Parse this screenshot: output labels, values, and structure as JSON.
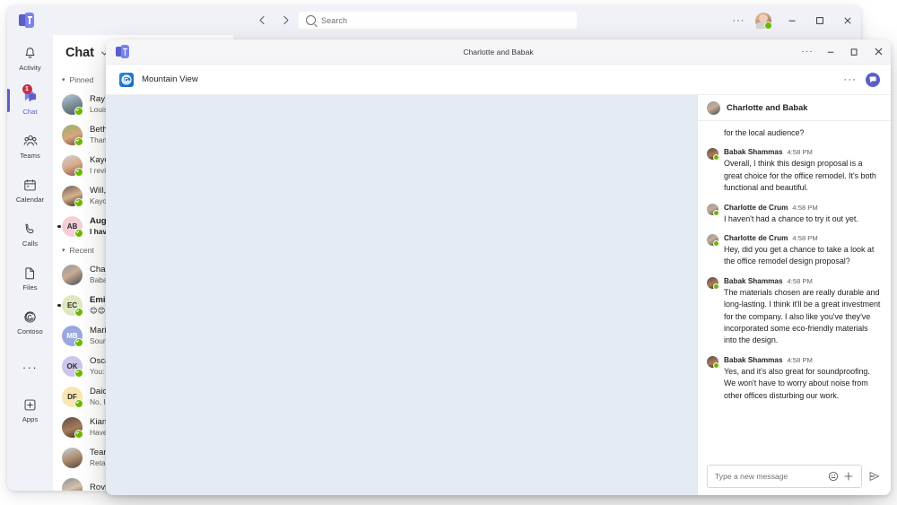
{
  "outer_window": {
    "logo_icon": "teams-logo-icon",
    "nav": {
      "back_icon": "chevron-left-icon",
      "forward_icon": "chevron-right-icon"
    },
    "search": {
      "placeholder": "Search",
      "icon": "search-icon"
    },
    "more_label": "···",
    "avatar_presence": "available",
    "controls": {
      "minimize": "‒",
      "maximize": "☐",
      "close": "✕"
    }
  },
  "rail": {
    "items": [
      {
        "label": "Activity",
        "icon": "bell-icon",
        "active": false,
        "badge": ""
      },
      {
        "label": "Chat",
        "icon": "chat-icon",
        "active": true,
        "badge": "1"
      },
      {
        "label": "Teams",
        "icon": "people-icon",
        "active": false,
        "badge": ""
      },
      {
        "label": "Calendar",
        "icon": "calendar-icon",
        "active": false,
        "badge": ""
      },
      {
        "label": "Calls",
        "icon": "phone-icon",
        "active": false,
        "badge": ""
      },
      {
        "label": "Files",
        "icon": "file-icon",
        "active": false,
        "badge": ""
      },
      {
        "label": "Contoso",
        "icon": "contoso-swirl-icon",
        "active": false,
        "badge": ""
      }
    ],
    "more_label": "···",
    "apps": {
      "label": "Apps",
      "icon": "apps-plus-icon"
    }
  },
  "chat_pane": {
    "title": "Chat",
    "chevron_icon": "chevron-down-icon",
    "groups": [
      {
        "name": "Pinned",
        "items": [
          {
            "name": "Ray Ta",
            "preview": "Louisa",
            "unread": false,
            "initials": "",
            "face": "f1"
          },
          {
            "name": "Beth D",
            "preview": "Thanks",
            "unread": false,
            "initials": "",
            "face": "f2"
          },
          {
            "name": "Kayo ",
            "preview": "I review",
            "unread": false,
            "initials": "",
            "face": "f3"
          },
          {
            "name": "Will, K",
            "preview": "Kayo: It",
            "unread": false,
            "initials": "",
            "face": "f4"
          },
          {
            "name": "Augu",
            "preview": "I haven",
            "unread": true,
            "initials": "AB",
            "face": ""
          }
        ]
      },
      {
        "name": "Recent",
        "items": [
          {
            "name": "Charlo",
            "preview": "Babak:",
            "unread": false,
            "initials": "",
            "face": "f5",
            "selected": true
          },
          {
            "name": "Emilia",
            "preview": "😊😊",
            "unread": true,
            "initials": "EC",
            "face": ""
          },
          {
            "name": "Marie",
            "preview": "Sounds",
            "unread": false,
            "initials": "MB",
            "face": ""
          },
          {
            "name": "Oscar",
            "preview": "You: Th",
            "unread": false,
            "initials": "OK",
            "face": ""
          },
          {
            "name": "Daichi",
            "preview": "No, I th",
            "unread": false,
            "initials": "DF",
            "face": ""
          },
          {
            "name": "Kian L",
            "preview": "Have y",
            "unread": false,
            "initials": "",
            "face": "f6"
          },
          {
            "name": "Team ",
            "preview": "Reta: L",
            "unread": false,
            "initials": "",
            "face": "f7"
          },
          {
            "name": "Rovin",
            "preview": "",
            "unread": false,
            "initials": "",
            "face": "f8"
          }
        ]
      }
    ]
  },
  "inner_window": {
    "title": "Charlotte and Babak",
    "logo_icon": "teams-logo-icon",
    "more_label": "···",
    "controls": {
      "minimize": "‒",
      "maximize": "☐",
      "close": "✕"
    },
    "app_bar": {
      "app_icon": "mountain-view-swirl-icon",
      "app_name": "Mountain View",
      "more_label": "···",
      "chat_toggle_icon": "chat-bubble-icon"
    },
    "chat_side": {
      "header_title": "Charlotte and Babak",
      "messages": [
        {
          "continuation": true,
          "author": "",
          "time": "",
          "text": "for the local audience?"
        },
        {
          "continuation": false,
          "author": "Babak Shammas",
          "time": "4:58 PM",
          "text": "Overall, I think this design proposal is a great choice for the office remodel. It's both functional and beautiful.",
          "face": "f6"
        },
        {
          "continuation": false,
          "author": "Charlotte de Crum",
          "time": "4:58 PM",
          "text": "I haven't had a chance to try it out yet.",
          "face": "f5"
        },
        {
          "continuation": false,
          "author": "Charlotte de Crum",
          "time": "4:58 PM",
          "text": "Hey, did you get a chance to take a look at the office remodel design proposal?",
          "face": "f5"
        },
        {
          "continuation": false,
          "author": "Babak Shammas",
          "time": "4:58 PM",
          "text": "The materials chosen are really durable and long-lasting. I think it'll be a great investment for the company. I also like you've they've incorporated some eco-friendly materials into the design.",
          "face": "f6"
        },
        {
          "continuation": false,
          "author": "Babak Shammas",
          "time": "4:58 PM",
          "text": "Yes, and it's also great for soundproofing. We won't have to worry about noise from other offices disturbing our work.",
          "face": "f6"
        }
      ],
      "composer": {
        "placeholder": "Type a new message",
        "emoji_icon": "emoji-icon",
        "plus_icon": "plus-icon",
        "send_icon": "send-icon"
      }
    }
  },
  "colors": {
    "brand": "#5b5fc7",
    "badge": "#c4314b",
    "presence_available": "#6bb700",
    "stage_bg": "#e5ebf2",
    "window_bg": "#f0f2f7"
  }
}
